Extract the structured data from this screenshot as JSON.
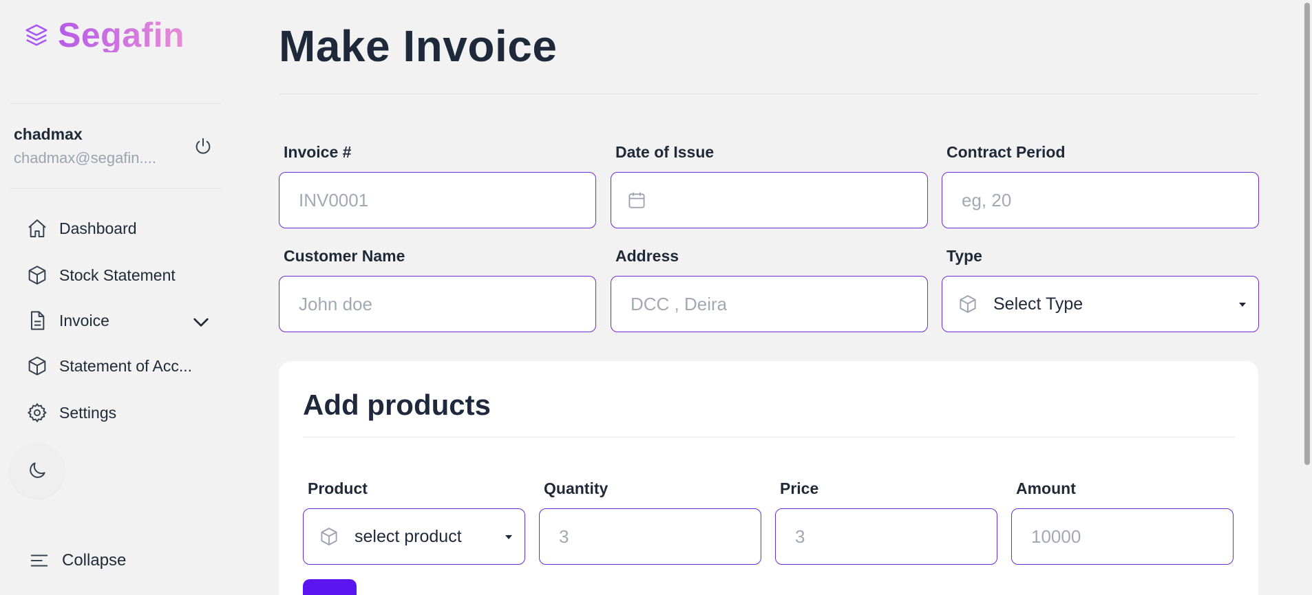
{
  "brand": {
    "name": "Segafin",
    "icon": "layers-icon"
  },
  "user": {
    "name": "chadmax",
    "email": "chadmax@segafin...."
  },
  "nav": {
    "items": [
      {
        "label": "Dashboard",
        "icon": "home-icon"
      },
      {
        "label": "Stock Statement",
        "icon": "cube-icon"
      },
      {
        "label": "Invoice",
        "icon": "document-icon"
      },
      {
        "label": "Statement of Acc...",
        "icon": "cube-icon"
      },
      {
        "label": "Settings",
        "icon": "gear-icon"
      }
    ],
    "collapse_label": "Collapse"
  },
  "page": {
    "title": "Make Invoice"
  },
  "form": {
    "invoice_no": {
      "label": "Invoice #",
      "placeholder": "INV0001"
    },
    "date_of_issue": {
      "label": "Date of Issue",
      "placeholder": ""
    },
    "contract_period": {
      "label": "Contract Period",
      "placeholder": "eg, 20"
    },
    "customer_name": {
      "label": "Customer Name",
      "placeholder": "John doe"
    },
    "address": {
      "label": "Address",
      "placeholder": "DCC , Deira"
    },
    "type": {
      "label": "Type",
      "value": "Select Type"
    }
  },
  "products": {
    "title": "Add products",
    "product": {
      "label": "Product",
      "value": "select product"
    },
    "quantity": {
      "label": "Quantity",
      "placeholder": "3"
    },
    "price": {
      "label": "Price",
      "placeholder": "3"
    },
    "amount": {
      "label": "Amount",
      "placeholder": "10000"
    },
    "add_label": "+"
  },
  "colors": {
    "accent": "#5b16f0",
    "input_border": "#6d28d9",
    "brand_gradient_start": "#b65be8",
    "brand_gradient_end": "#e78cd6"
  }
}
